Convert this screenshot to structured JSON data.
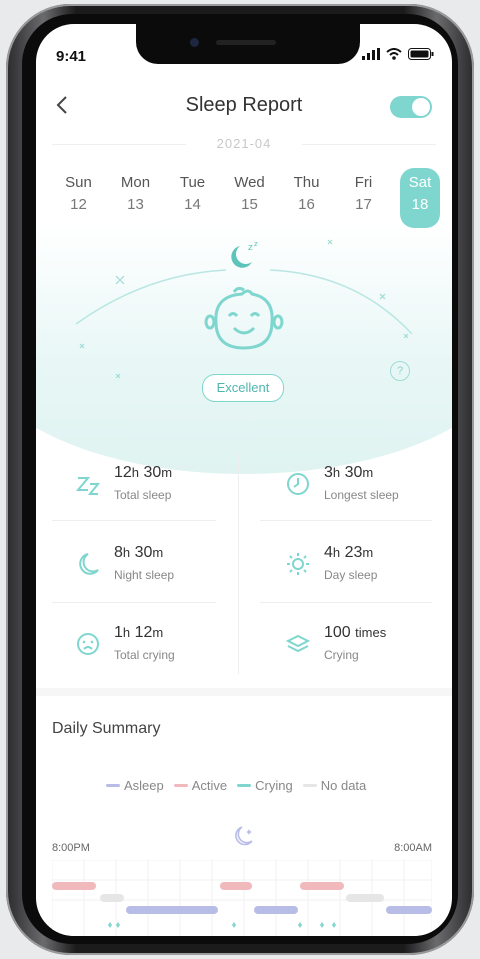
{
  "status": {
    "time": "9:41"
  },
  "header": {
    "title": "Sleep Report",
    "toggle_on": true
  },
  "month": "2021-04",
  "days": [
    {
      "name": "Sun",
      "date": "12"
    },
    {
      "name": "Mon",
      "date": "13"
    },
    {
      "name": "Tue",
      "date": "14"
    },
    {
      "name": "Wed",
      "date": "15"
    },
    {
      "name": "Thu",
      "date": "16"
    },
    {
      "name": "Fri",
      "date": "17"
    },
    {
      "name": "Sat",
      "date": "18"
    }
  ],
  "rating": "Excellent",
  "stats": {
    "total_sleep": {
      "h": "12",
      "m": "30",
      "label": "Total sleep"
    },
    "longest_sleep": {
      "h": "3",
      "m": "30",
      "label": "Longest sleep"
    },
    "night_sleep": {
      "h": "8",
      "m": "30",
      "label": "Night sleep"
    },
    "day_sleep": {
      "h": "4",
      "m": "23",
      "label": "Day sleep"
    },
    "total_crying": {
      "h": "1",
      "m": "12",
      "label": "Total crying"
    },
    "crying": {
      "count": "100",
      "unit": "times",
      "label": "Crying"
    }
  },
  "summary": {
    "title": "Daily Summary",
    "legend": [
      {
        "label": "Asleep",
        "color": "#b8bde8"
      },
      {
        "label": "Active",
        "color": "#f2b9bd"
      },
      {
        "label": "Crying",
        "color": "#7fd6cf"
      },
      {
        "label": "No data",
        "color": "#e6e6e6"
      }
    ],
    "start_time": "8:00PM",
    "end_time": "8:00AM"
  },
  "colors": {
    "accent": "#7fd6cf",
    "asleep": "#b8bde8",
    "active": "#f2b9bd",
    "nodata": "#e6e6e6"
  },
  "units": {
    "h": "h",
    "m": "m"
  }
}
